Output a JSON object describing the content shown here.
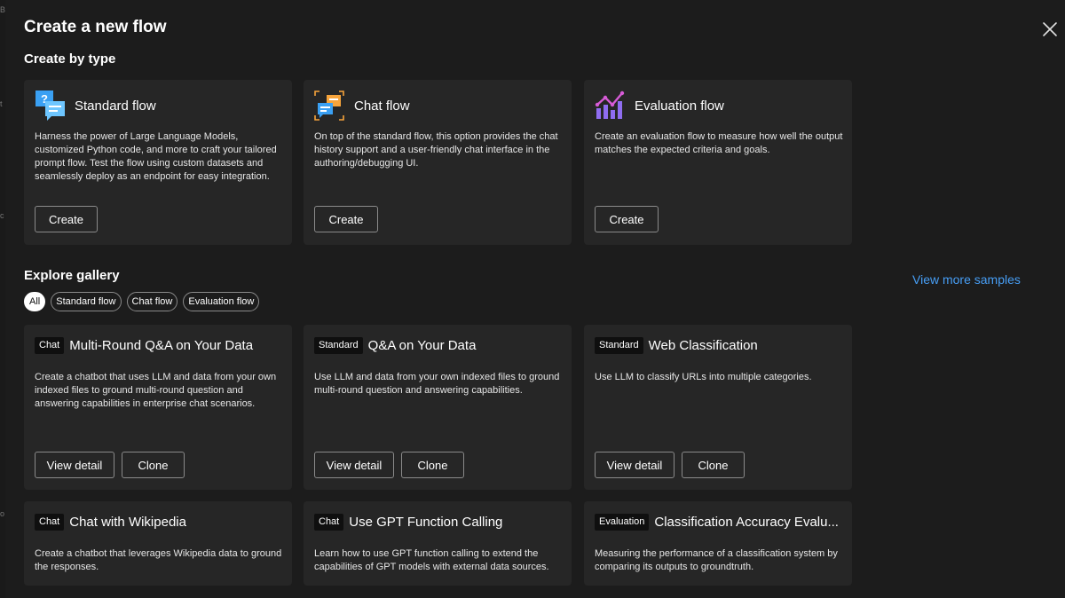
{
  "dialog": {
    "title": "Create a new flow",
    "close_icon": "close-icon"
  },
  "edge_strip": [
    "B",
    "t",
    "c",
    "o"
  ],
  "create_by_type": {
    "heading": "Create by type",
    "cards": [
      {
        "icon": "standard-flow-icon",
        "name": "Standard flow",
        "description": "Harness the power of Large Language Models, customized Python code, and more to craft your tailored prompt flow. Test the flow using custom datasets and seamlessly deploy as an endpoint for easy integration.",
        "button": "Create"
      },
      {
        "icon": "chat-flow-icon",
        "name": "Chat flow",
        "description": "On top of the standard flow, this option provides the chat history support and a user-friendly chat interface in the authoring/debugging UI.",
        "button": "Create"
      },
      {
        "icon": "evaluation-flow-icon",
        "name": "Evaluation flow",
        "description": "Create an evaluation flow to measure how well the output matches the expected criteria and goals.",
        "button": "Create"
      }
    ]
  },
  "gallery": {
    "heading": "Explore gallery",
    "view_more": "View more samples",
    "filters": [
      "All",
      "Standard flow",
      "Chat flow",
      "Evaluation flow"
    ],
    "active_filter": "All",
    "view_detail_label": "View detail",
    "clone_label": "Clone",
    "samples": [
      {
        "badge": "Chat",
        "title": "Multi-Round Q&A on Your Data",
        "description": "Create a chatbot that uses LLM and data from your own indexed files to ground multi-round question and answering capabilities in enterprise chat scenarios."
      },
      {
        "badge": "Standard",
        "title": "Q&A on Your Data",
        "description": "Use LLM and data from your own indexed files to ground multi-round question and answering capabilities."
      },
      {
        "badge": "Standard",
        "title": "Web Classification",
        "description": "Use LLM to classify URLs into multiple categories."
      },
      {
        "badge": "Chat",
        "title": "Chat with Wikipedia",
        "description": "Create a chatbot that leverages Wikipedia data to ground the responses."
      },
      {
        "badge": "Chat",
        "title": "Use GPT Function Calling",
        "description": "Learn how to use GPT function calling to extend the capabilities of GPT models with external data sources."
      },
      {
        "badge": "Evaluation",
        "title": "Classification Accuracy Evalu...",
        "description": "Measuring the performance of a classification system by comparing its outputs to groundtruth."
      }
    ]
  },
  "colors": {
    "background": "#1c1c1c",
    "card": "#262626",
    "link": "#479ef5",
    "icon_blue": "#3aa0f3",
    "icon_orange": "#f7a43b",
    "icon_purple": "#8f6df0"
  }
}
